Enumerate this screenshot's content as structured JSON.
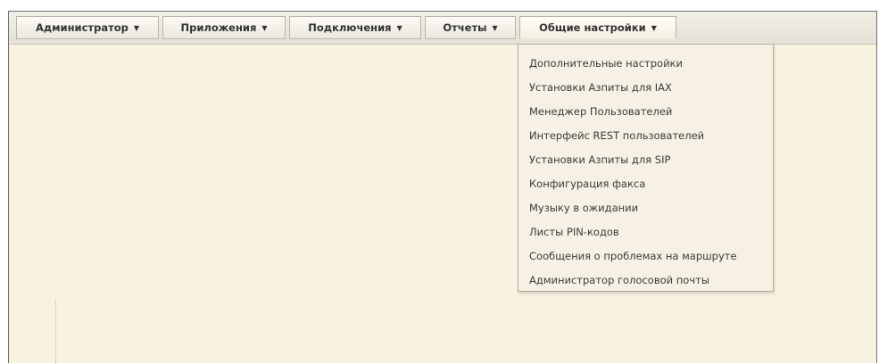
{
  "menubar": {
    "items": [
      {
        "label": "Администратор"
      },
      {
        "label": "Приложения"
      },
      {
        "label": "Подключения"
      },
      {
        "label": "Отчеты"
      },
      {
        "label": "Общие настройки",
        "active": true
      }
    ],
    "caret_icon": "caret-down-icon"
  },
  "dropdown": {
    "items": [
      "Дополнительные настройки",
      "Установки Азпиты для IAX",
      "Менеджер Пользователей",
      "Интерфейс REST пользователей",
      "Установки Азпиты для SIP",
      "Конфигурация факса",
      "Музыку в ожидании",
      "Листы PIN-кодов",
      "Сообщения о проблемах на маршруте",
      "Администратор голосовой почты"
    ]
  },
  "colors": {
    "page_background": "#f8f3e1",
    "menu_text": "#333333",
    "dropdown_background": "#f6f1e4"
  }
}
